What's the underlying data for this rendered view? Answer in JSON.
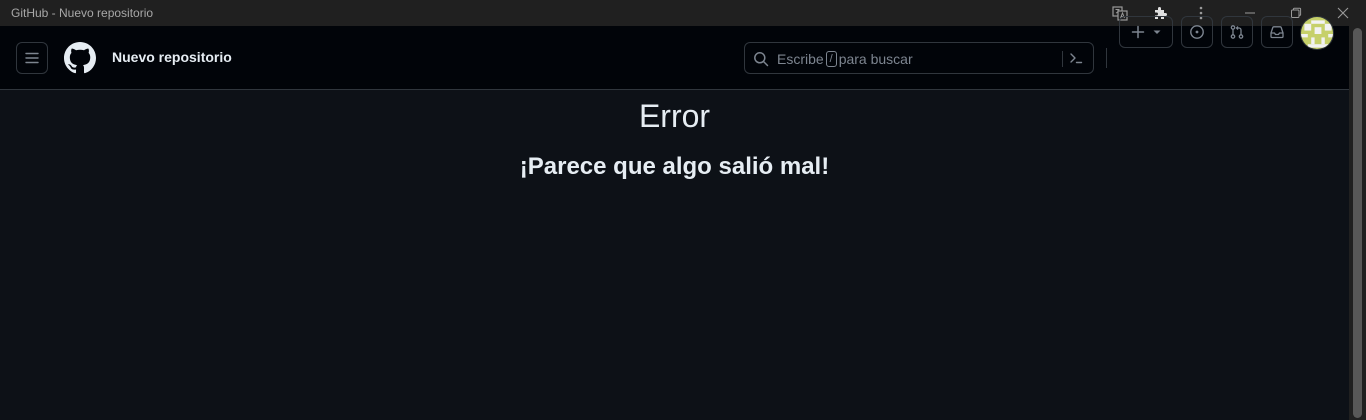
{
  "window": {
    "title": "GitHub - Nuevo repositorio",
    "controls": [
      "translate-icon",
      "extensions-icon",
      "more-vert-icon",
      "minimize-icon",
      "restore-icon",
      "close-icon"
    ]
  },
  "header": {
    "context_label": "Nuevo repositorio",
    "search": {
      "placeholder_before": "Escribe",
      "kbd": "/",
      "placeholder_after": "para buscar"
    },
    "buttons": [
      "menu-icon",
      "plus-icon",
      "issues-icon",
      "pull-request-icon",
      "inbox-icon"
    ]
  },
  "main": {
    "title": "Error",
    "subtitle": "¡Parece que algo salió mal!"
  },
  "colors": {
    "background": "#0d1117",
    "header_bg": "#010409",
    "border": "#30363d",
    "text": "#e6edf3",
    "muted": "#7d8590"
  }
}
